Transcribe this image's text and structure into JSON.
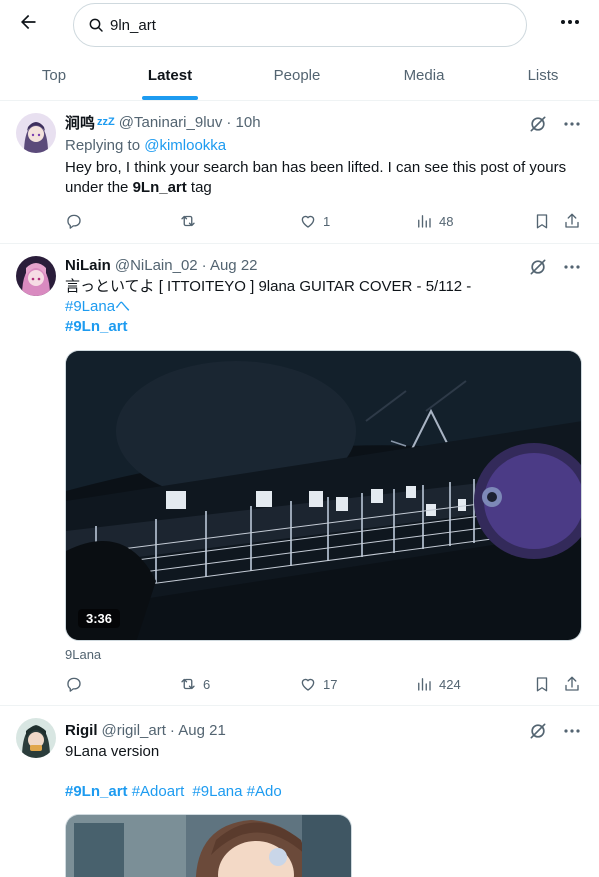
{
  "header": {
    "search_value": "9ln_art",
    "icons": {
      "back": "arrow-left-icon",
      "search": "search-icon",
      "more": "more-horizontal-icon"
    }
  },
  "tabs": [
    {
      "label": "Top",
      "active": false
    },
    {
      "label": "Latest",
      "active": true
    },
    {
      "label": "People",
      "active": false
    },
    {
      "label": "Media",
      "active": false
    },
    {
      "label": "Lists",
      "active": false
    }
  ],
  "tweets": [
    {
      "name": "涧鸣",
      "name_suffix": "zzZ",
      "handle": "@Taninari_9luv",
      "time": "· 10h",
      "reply_prefix": "Replying to",
      "reply_to": "@kimlookka",
      "text_1": "Hey bro, I think your search ban has been lifted. I can see this post of yours",
      "text_2_a": "under the",
      "text_2_bold": "9Ln_art",
      "text_2_b": "tag",
      "replies": "",
      "reposts": "",
      "likes": "1",
      "views": "48"
    },
    {
      "name": "NiLain",
      "handle": "@NiLain_02",
      "time": "· Aug 22",
      "text_1": "言っといてよ [ ITTOITEYO ] 9lana GUITAR COVER - 5/112 -",
      "hashtag_1": "#9Lanaへ",
      "hashtag_2": "#9Ln_art",
      "video_duration": "3:36",
      "source": "9Lana",
      "replies": "",
      "reposts": "6",
      "likes": "17",
      "views": "424"
    },
    {
      "name": "Rigil",
      "handle": "@rigil_art",
      "time": "· Aug 21",
      "text_1": "9Lana version",
      "hashtags": [
        "#9Ln_art",
        "#Adoart",
        "#9Lana",
        "#Ado"
      ]
    }
  ],
  "colors": {
    "accent": "#1d9bf0",
    "secondary_text": "#536471",
    "border": "#eff3f4"
  }
}
